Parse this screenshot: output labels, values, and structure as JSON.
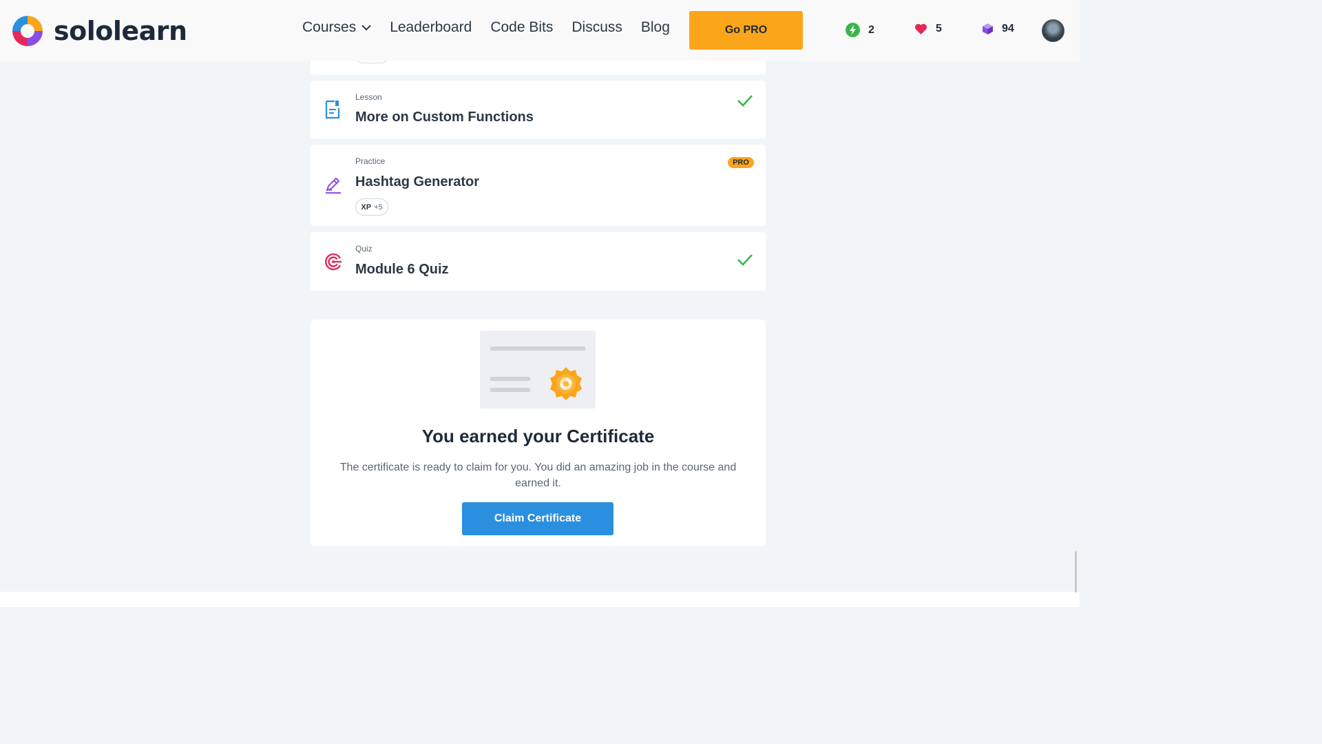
{
  "brand": {
    "name": "sololearn",
    "colors": {
      "orange": "#fba51b",
      "pink": "#e5285a",
      "blue": "#2a8fde",
      "purple": "#8a4fe0",
      "green": "#3bb54a"
    }
  },
  "nav": {
    "items": [
      {
        "label": "Courses",
        "has_dropdown": true,
        "icon": "chevron-down-icon"
      },
      {
        "label": "Leaderboard"
      },
      {
        "label": "Code Bits"
      },
      {
        "label": "Discuss"
      },
      {
        "label": "Blog"
      }
    ],
    "go_pro_label": "Go PRO"
  },
  "stats": {
    "streak": {
      "icon": "lightning-icon",
      "value": "2"
    },
    "hearts": {
      "icon": "heart-icon",
      "value": "5"
    },
    "bits": {
      "icon": "cube-icon",
      "value": "94"
    }
  },
  "items": [
    {
      "kind": "Lesson",
      "title": "More on Custom Functions",
      "icon": "lesson-document-icon",
      "completed": true
    },
    {
      "kind": "Practice",
      "title": "Hashtag Generator",
      "icon": "pencil-icon",
      "pro_badge": "PRO",
      "xp_label": "XP",
      "xp_value": "+5"
    },
    {
      "kind": "Quiz",
      "title": "Module 6 Quiz",
      "icon": "target-icon",
      "completed": true
    }
  ],
  "certificate": {
    "title": "You earned your Certificate",
    "description": "The certificate is ready to claim for you. You did an amazing job in the course and earned it.",
    "button_label": "Claim Certificate",
    "illustration_icon": "certificate-icon"
  }
}
